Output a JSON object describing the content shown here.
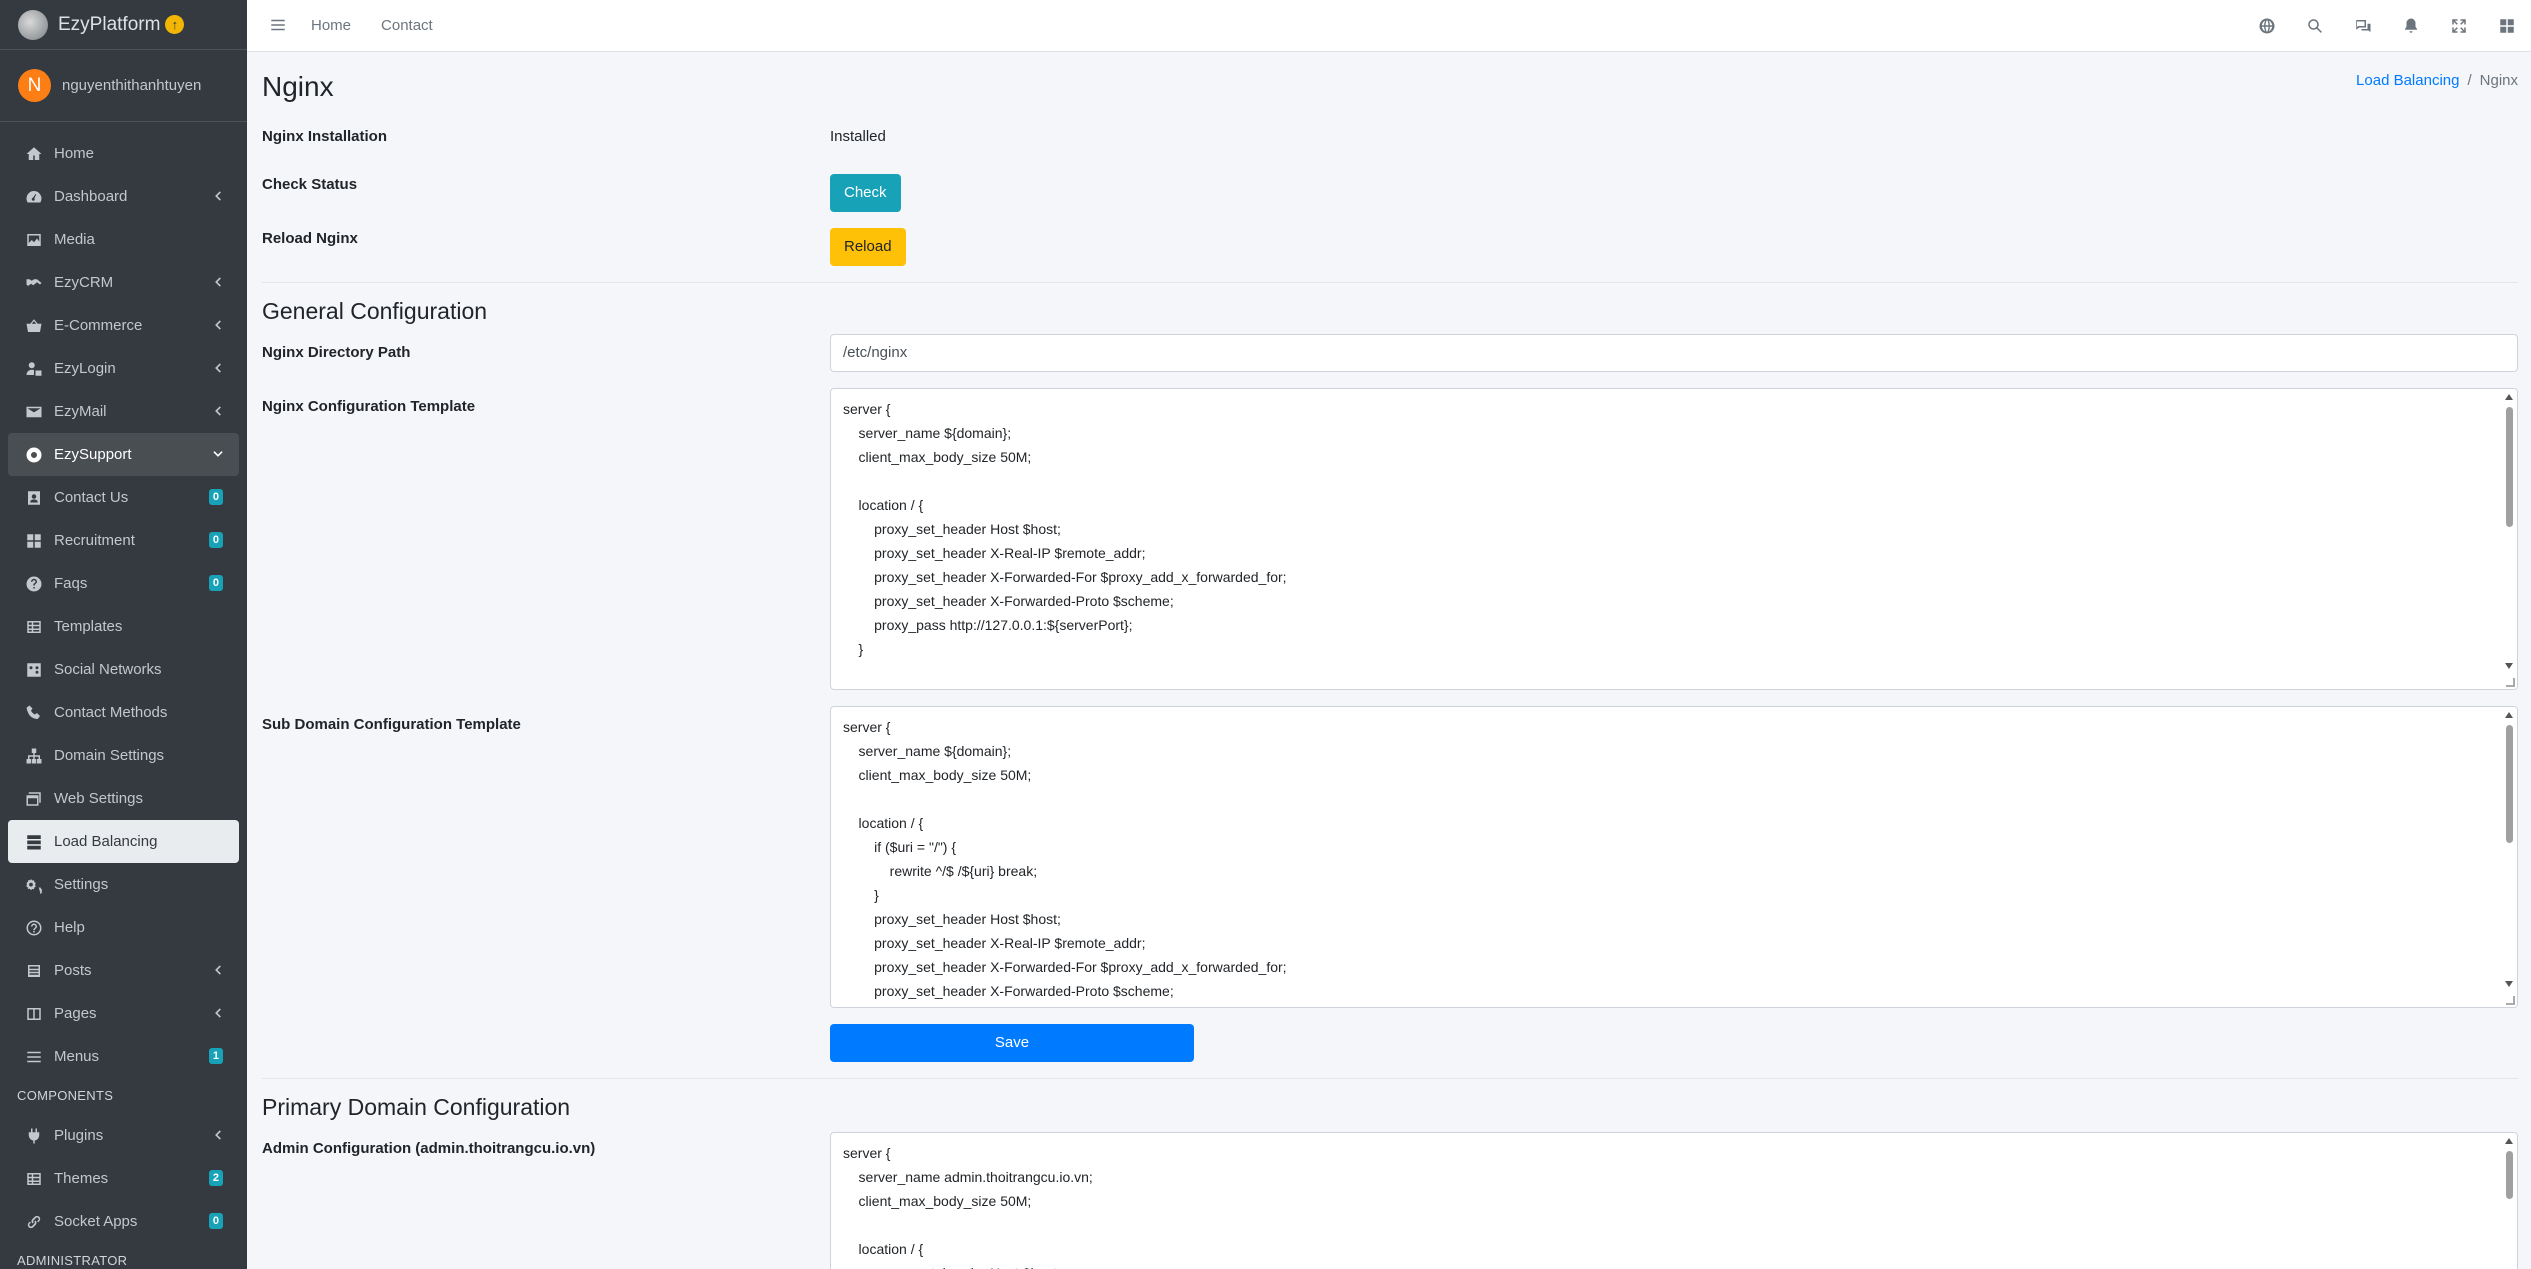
{
  "brand": {
    "name": "EzyPlatform",
    "badge": "↑"
  },
  "user": {
    "initial": "N",
    "name": "nguyenthithanhtuyen"
  },
  "sidebar": {
    "items": [
      {
        "label": "Home"
      },
      {
        "label": "Dashboard"
      },
      {
        "label": "Media"
      },
      {
        "label": "EzyCRM"
      },
      {
        "label": "E-Commerce"
      },
      {
        "label": "EzyLogin"
      },
      {
        "label": "EzyMail"
      },
      {
        "label": "EzySupport"
      },
      {
        "label": "Contact Us",
        "badge": "0"
      },
      {
        "label": "Recruitment",
        "badge": "0"
      },
      {
        "label": "Faqs",
        "badge": "0"
      },
      {
        "label": "Templates"
      },
      {
        "label": "Social Networks"
      },
      {
        "label": "Contact Methods"
      },
      {
        "label": "Domain Settings"
      },
      {
        "label": "Web Settings"
      },
      {
        "label": "Load Balancing"
      },
      {
        "label": "Settings"
      },
      {
        "label": "Help"
      },
      {
        "label": "Posts"
      },
      {
        "label": "Pages"
      },
      {
        "label": "Menus",
        "badge": "1"
      },
      {
        "label": "Plugins"
      },
      {
        "label": "Themes",
        "badge": "2"
      },
      {
        "label": "Socket Apps",
        "badge": "0"
      }
    ],
    "components_header": "COMPONENTS",
    "administrator_header": "ADMINISTRATOR"
  },
  "topbar": {
    "links": [
      "Home",
      "Contact"
    ]
  },
  "page": {
    "title": "Nginx",
    "breadcrumb": {
      "parent": "Load Balancing",
      "separator": "/",
      "current": "Nginx"
    }
  },
  "nginx": {
    "installation_label": "Nginx Installation",
    "installation_value": "Installed",
    "check_label": "Check Status",
    "check_button": "Check",
    "reload_label": "Reload Nginx",
    "reload_button": "Reload"
  },
  "general": {
    "title": "General Configuration",
    "dir_label": "Nginx Directory Path",
    "dir_value": "/etc/nginx",
    "template_label": "Nginx Configuration Template",
    "template_value": "server {\n    server_name ${domain};\n    client_max_body_size 50M;\n\n    location / {\n        proxy_set_header Host $host;\n        proxy_set_header X-Real-IP $remote_addr;\n        proxy_set_header X-Forwarded-For $proxy_add_x_forwarded_for;\n        proxy_set_header X-Forwarded-Proto $scheme;\n        proxy_pass http://127.0.0.1:${serverPort};\n    }",
    "sub_label": "Sub Domain Configuration Template",
    "sub_value": "server {\n    server_name ${domain};\n    client_max_body_size 50M;\n\n    location / {\n        if ($uri = \"/\") {\n            rewrite ^/$ /${uri} break;\n        }\n        proxy_set_header Host $host;\n        proxy_set_header X-Real-IP $remote_addr;\n        proxy_set_header X-Forwarded-For $proxy_add_x_forwarded_for;\n        proxy_set_header X-Forwarded-Proto $scheme;",
    "save_button": "Save"
  },
  "primary": {
    "title": "Primary Domain Configuration",
    "admin_label": "Admin Configuration (admin.thoitrangcu.io.vn)",
    "admin_value": "server {\n    server_name admin.thoitrangcu.io.vn;\n    client_max_body_size 50M;\n\n    location / {\n        proxy_set_header Host $host;"
  }
}
